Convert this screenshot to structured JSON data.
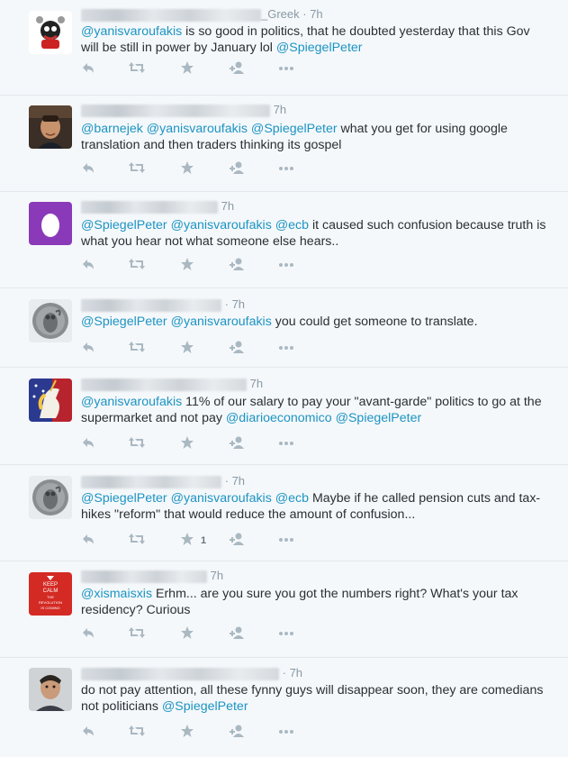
{
  "tweets": [
    {
      "header_suffix": "_Greek",
      "time": "7h",
      "parts": [
        {
          "text": "@yanisvaroufakis",
          "mention": true
        },
        {
          "text": " is so good in politics, that he doubted yesterday that this Gov will be still in power by January lol ",
          "mention": false
        },
        {
          "text": "@SpiegelPeter",
          "mention": true
        }
      ],
      "avatar": "cartoon-character-avatar",
      "favorites": ""
    },
    {
      "header_suffix": "",
      "time": "7h",
      "parts": [
        {
          "text": "@barnejek",
          "mention": true
        },
        {
          "text": " ",
          "mention": false
        },
        {
          "text": "@yanisvaroufakis",
          "mention": true
        },
        {
          "text": " ",
          "mention": false
        },
        {
          "text": "@SpiegelPeter",
          "mention": true
        },
        {
          "text": " what you get for using google translation and then traders thinking its gospel",
          "mention": false
        }
      ],
      "avatar": "man-portrait-avatar",
      "favorites": ""
    },
    {
      "header_suffix": "",
      "time": "7h",
      "parts": [
        {
          "text": "@SpiegelPeter",
          "mention": true
        },
        {
          "text": " ",
          "mention": false
        },
        {
          "text": "@yanisvaroufakis",
          "mention": true
        },
        {
          "text": " ",
          "mention": false
        },
        {
          "text": "@ecb",
          "mention": true
        },
        {
          "text": " it caused such confusion because  truth is what you hear not what someone else hears..",
          "mention": false
        }
      ],
      "avatar": "default-egg-avatar",
      "favorites": ""
    },
    {
      "header_suffix": "",
      "time": "7h",
      "parts": [
        {
          "text": "@SpiegelPeter",
          "mention": true
        },
        {
          "text": " ",
          "mention": false
        },
        {
          "text": "@yanisvaroufakis",
          "mention": true
        },
        {
          "text": " you could get someone to translate.",
          "mention": false
        }
      ],
      "avatar": "owl-coin-avatar",
      "favorites": ""
    },
    {
      "header_suffix": "",
      "time": "7h",
      "parts": [
        {
          "text": "@yanisvaroufakis",
          "mention": true
        },
        {
          "text": " 11% of our salary to pay your \"avant-garde\" politics to go at the supermarket and not pay ",
          "mention": false
        },
        {
          "text": "@diarioeconomico",
          "mention": true
        },
        {
          "text": " ",
          "mention": false
        },
        {
          "text": "@SpiegelPeter",
          "mention": true
        }
      ],
      "avatar": "unicorn-avatar",
      "favorites": ""
    },
    {
      "header_suffix": "",
      "time": "7h",
      "parts": [
        {
          "text": "@SpiegelPeter",
          "mention": true
        },
        {
          "text": " ",
          "mention": false
        },
        {
          "text": "@yanisvaroufakis",
          "mention": true
        },
        {
          "text": " ",
          "mention": false
        },
        {
          "text": "@ecb",
          "mention": true
        },
        {
          "text": " Maybe if he called pension cuts and tax-hikes \"reform\" that would reduce the amount of confusion...",
          "mention": false
        }
      ],
      "avatar": "owl-coin-avatar",
      "favorites": "1"
    },
    {
      "header_suffix": "",
      "time": "7h",
      "parts": [
        {
          "text": "@xismaisxis",
          "mention": true
        },
        {
          "text": " Erhm... are you sure you got the numbers right? What's your tax residency? Curious",
          "mention": false
        }
      ],
      "avatar": "keep-calm-poster-avatar",
      "favorites": ""
    },
    {
      "header_suffix": "",
      "time": "7h",
      "parts": [
        {
          "text": "do not pay attention, all these fynny guys will disappear soon, they are comedians not politicians ",
          "mention": false
        },
        {
          "text": "@SpiegelPeter",
          "mention": true
        }
      ],
      "avatar": "man-portrait-avatar",
      "favorites": ""
    }
  ],
  "poster_text": {
    "line1": "KEEP",
    "line2": "CALM",
    "line3": "THE",
    "line4": "REVOLUTION",
    "line5": "IS COMING"
  },
  "colors": {
    "mention": "#1c94c4",
    "text": "#292f33",
    "muted": "#8899a6",
    "icon": "#aab8c2",
    "background": "#f5f8fa",
    "divider": "#e1e8ed"
  },
  "icons": [
    "reply-icon",
    "retweet-icon",
    "favorite-icon",
    "follow-icon",
    "more-icon"
  ]
}
